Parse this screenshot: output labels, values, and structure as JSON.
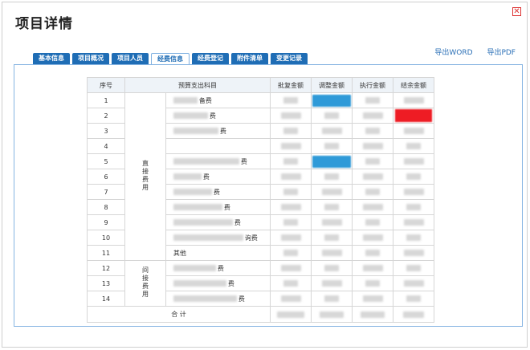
{
  "header": {
    "title": "项目详情",
    "close_glyph": "✕"
  },
  "actions": {
    "export_word": "导出WORD",
    "export_pdf": "导出PDF"
  },
  "tabs": [
    {
      "label": "基本信息",
      "active": false
    },
    {
      "label": "项目概况",
      "active": false
    },
    {
      "label": "项目人员",
      "active": false
    },
    {
      "label": "经费信息",
      "active": true
    },
    {
      "label": "经费登记",
      "active": false
    },
    {
      "label": "附件清单",
      "active": false
    },
    {
      "label": "变更记录",
      "active": false
    }
  ],
  "table": {
    "headers": {
      "no": "序号",
      "subject": "预算支出科目",
      "approved": "批复金额",
      "adjusted": "调整金额",
      "executed": "执行金额",
      "balance": "结余金额"
    },
    "group_direct": "直接费用",
    "group_indirect": "间接费用",
    "rows": [
      {
        "no": "1",
        "subject": "备费"
      },
      {
        "no": "2",
        "subject": "费"
      },
      {
        "no": "3",
        "subject": "费"
      },
      {
        "no": "4",
        "subject": ""
      },
      {
        "no": "5",
        "subject": "费"
      },
      {
        "no": "6",
        "subject": "费"
      },
      {
        "no": "7",
        "subject": "费"
      },
      {
        "no": "8",
        "subject": "费"
      },
      {
        "no": "9",
        "subject": "费"
      },
      {
        "no": "10",
        "subject": "询费"
      },
      {
        "no": "11",
        "subject": "其他"
      },
      {
        "no": "12",
        "subject": "费"
      },
      {
        "no": "13",
        "subject": "费"
      },
      {
        "no": "14",
        "subject": "费"
      }
    ],
    "total_label": "合 计"
  },
  "colors": {
    "tab_blue": "#1f6db5",
    "highlight_blue": "#2f9ad8",
    "highlight_red": "#ee1c24"
  }
}
